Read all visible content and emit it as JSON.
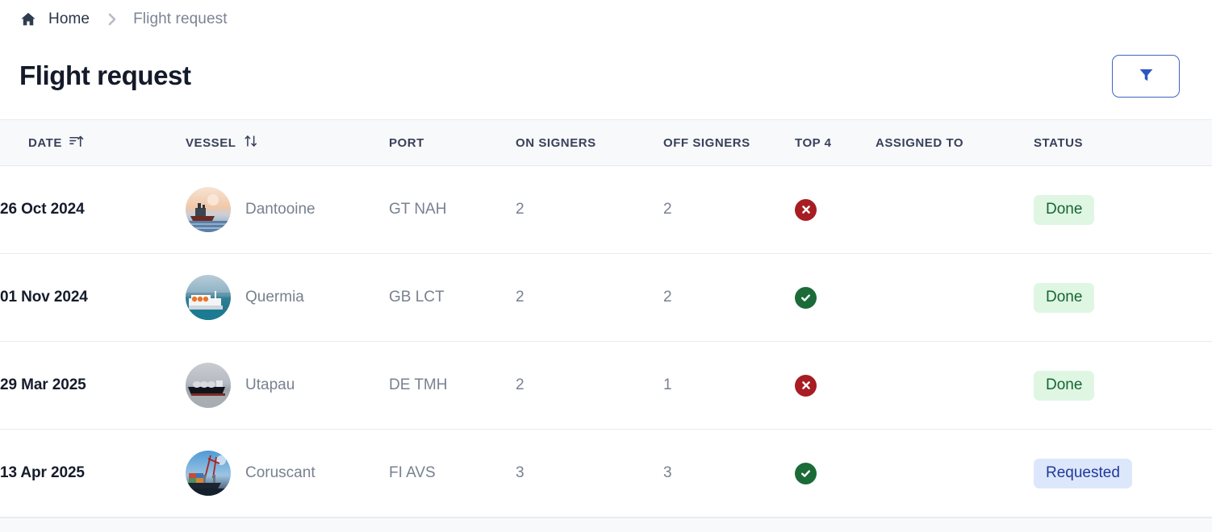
{
  "breadcrumb": {
    "home_label": "Home",
    "current_label": "Flight request",
    "home_icon": "home-icon",
    "separator_icon": "chevron-right-icon"
  },
  "header": {
    "title": "Flight request",
    "filter_button_icon": "filter-funnel-icon",
    "accent_color": "#3f63c8"
  },
  "table": {
    "columns": [
      {
        "label": "DATE",
        "sort_icon": "sort-ascending-icon"
      },
      {
        "label": "VESSEL",
        "sort_icon": "sort-updown-icon"
      },
      {
        "label": "PORT",
        "sort_icon": ""
      },
      {
        "label": "ON SIGNERS",
        "sort_icon": ""
      },
      {
        "label": "OFF SIGNERS",
        "sort_icon": ""
      },
      {
        "label": "TOP 4",
        "sort_icon": ""
      },
      {
        "label": "ASSIGNED TO",
        "sort_icon": ""
      },
      {
        "label": "STATUS",
        "sort_icon": ""
      }
    ],
    "rows": [
      {
        "date": "26 Oct 2024",
        "vessel": "Dantooine",
        "avatar_icon": "vessel-photo-sunset-ship",
        "port": "GT NAH",
        "on_signers": "2",
        "off_signers": "2",
        "top4": "no",
        "top4_icon": "circle-x-icon",
        "assigned_to": "",
        "status": "Done",
        "status_style": "done"
      },
      {
        "date": "01 Nov 2024",
        "vessel": "Quermia",
        "avatar_icon": "vessel-photo-white-ferry",
        "port": "GB LCT",
        "on_signers": "2",
        "off_signers": "2",
        "top4": "yes",
        "top4_icon": "circle-check-icon",
        "assigned_to": "",
        "status": "Done",
        "status_style": "done"
      },
      {
        "date": "29 Mar 2025",
        "vessel": "Utapau",
        "avatar_icon": "vessel-photo-gas-carrier",
        "port": "DE TMH",
        "on_signers": "2",
        "off_signers": "1",
        "top4": "no",
        "top4_icon": "circle-x-icon",
        "assigned_to": "",
        "status": "Done",
        "status_style": "done"
      },
      {
        "date": "13 Apr 2025",
        "vessel": "Coruscant",
        "avatar_icon": "vessel-photo-container-cranes",
        "port": "FI AVS",
        "on_signers": "3",
        "off_signers": "3",
        "top4": "yes",
        "top4_icon": "circle-check-icon",
        "assigned_to": "",
        "status": "Requested",
        "status_style": "requested"
      }
    ]
  },
  "colors": {
    "status_done_bg": "#dff6e3",
    "status_done_text": "#166633",
    "status_requested_bg": "#dce7fb",
    "status_requested_text": "#20399b",
    "top4_yes": "#1b6b38",
    "top4_no": "#a71d23"
  }
}
